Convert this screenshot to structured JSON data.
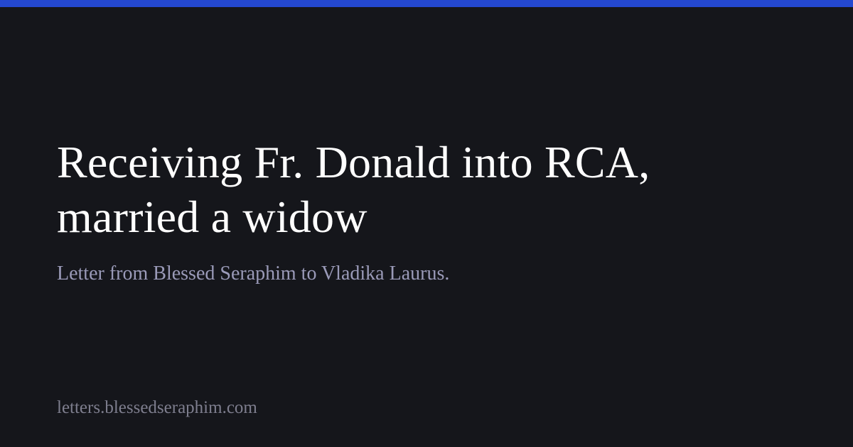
{
  "colors": {
    "background": "#15161b",
    "accent": "#2448d0",
    "title": "#ffffff",
    "subtitle": "#9a9ab8",
    "site": "#7e7e8e"
  },
  "card": {
    "title": "Receiving Fr. Donald into RCA, married a widow",
    "subtitle": "Letter from Blessed Seraphim to Vladika Laurus.",
    "site": "letters.blessedseraphim.com"
  }
}
